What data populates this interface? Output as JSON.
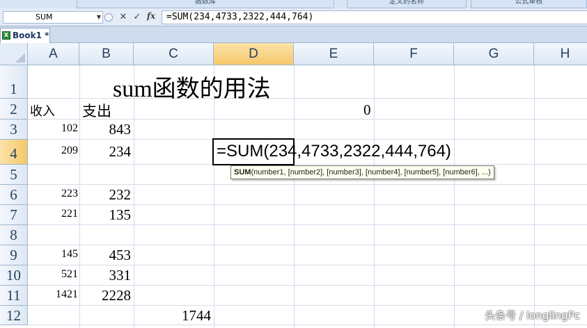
{
  "ribbon": {
    "groups": [
      "函数库",
      "定义的名称",
      "公式审核"
    ]
  },
  "formula_bar": {
    "name_box": "SUM",
    "cancel_icon": "✕",
    "enter_icon": "✓",
    "fx_label": "fx",
    "formula": "=SUM(234,4733,2322,444,764)"
  },
  "workbook": {
    "tab_label": "Book1 *"
  },
  "columns": [
    "A",
    "B",
    "C",
    "D",
    "E",
    "F",
    "G",
    "H"
  ],
  "rows": [
    "1",
    "2",
    "3",
    "4",
    "5",
    "6",
    "7",
    "8",
    "9",
    "10",
    "11",
    "12"
  ],
  "active": {
    "column": "D",
    "row": "4"
  },
  "cells": {
    "B1": "sum函数的用法",
    "A2": "收入",
    "B2": "支出",
    "E2": "0",
    "A3": "102",
    "B3": "843",
    "A4": "209",
    "B4": "234",
    "A6": "223",
    "B6": "232",
    "A7": "221",
    "B7": "135",
    "A9": "145",
    "B9": "453",
    "A10": "521",
    "B10": "331",
    "A11": "1421",
    "B11": "2228",
    "C12": "1744"
  },
  "editing": {
    "text": "=SUM(234,4733,2322,444,764)"
  },
  "tooltip": {
    "func": "SUM",
    "args": "(number1, [number2], [number3], [number4], [number5], [number6], ...)"
  },
  "watermark": "头条号 / longlingPc"
}
